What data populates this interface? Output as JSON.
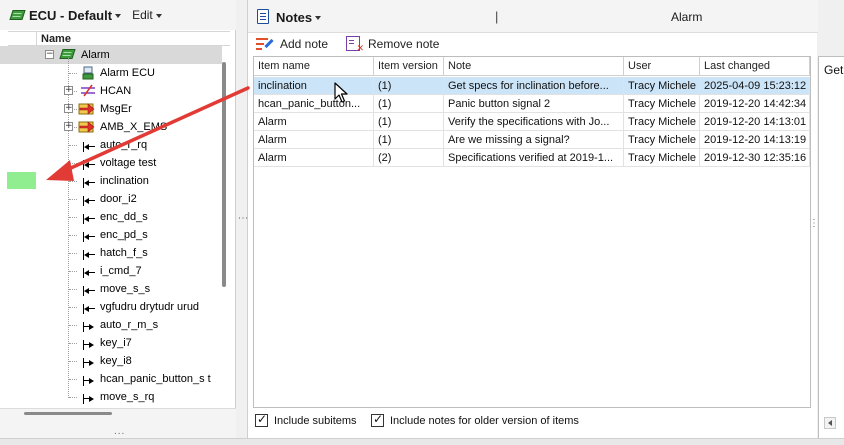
{
  "left_panel": {
    "title": "ECU - Default",
    "edit_menu": "Edit",
    "tree_header": "Name",
    "root": {
      "label": "Alarm"
    },
    "items": [
      {
        "label": "Alarm ECU",
        "icon": "ecu-module-icon"
      },
      {
        "label": "HCAN",
        "icon": "can-bus-icon"
      },
      {
        "label": "MsgEr",
        "icon": "message-icon"
      },
      {
        "label": "AMB_X_EMS",
        "icon": "message-icon"
      },
      {
        "label": "auto_r_rq",
        "icon": "signal-in-icon"
      },
      {
        "label": "voltage test",
        "icon": "signal-in-icon"
      },
      {
        "label": "inclination",
        "icon": "signal-in-icon"
      },
      {
        "label": "door_i2",
        "icon": "signal-in-icon"
      },
      {
        "label": "enc_dd_s",
        "icon": "signal-in-icon"
      },
      {
        "label": "enc_pd_s",
        "icon": "signal-in-icon"
      },
      {
        "label": "hatch_f_s",
        "icon": "signal-in-icon"
      },
      {
        "label": "i_cmd_7",
        "icon": "signal-in-icon"
      },
      {
        "label": "move_s_s",
        "icon": "signal-in-icon"
      },
      {
        "label": "vgfudru drytudr urud",
        "icon": "signal-in-icon"
      },
      {
        "label": "auto_r_m_s",
        "icon": "signal-out-icon"
      },
      {
        "label": "key_i7",
        "icon": "signal-out-icon"
      },
      {
        "label": "key_i8",
        "icon": "signal-out-icon"
      },
      {
        "label": "hcan_panic_button_s t",
        "icon": "signal-out-icon"
      },
      {
        "label": "move_s_rq",
        "icon": "signal-out-icon"
      }
    ],
    "bottom_grip": "..."
  },
  "notes_panel": {
    "title": "Notes",
    "separator": "|",
    "context_title": "Alarm",
    "add_note": "Add note",
    "remove_note": "Remove note",
    "columns": [
      "Item name",
      "Item version",
      "Note",
      "User",
      "Last changed"
    ],
    "rows": [
      {
        "item_name": "inclination",
        "item_version": "(1)",
        "note": "Get specs for inclination before...",
        "user": "Tracy Michele",
        "last_changed": "2025-04-09 15:23:12",
        "selected": true
      },
      {
        "item_name": "hcan_panic_button...",
        "item_version": "(1)",
        "note": "Panic button signal 2",
        "user": "Tracy Michele",
        "last_changed": "2019-12-20 14:42:34",
        "selected": false
      },
      {
        "item_name": "Alarm",
        "item_version": "(1)",
        "note": "Verify the specifications with Jo...",
        "user": "Tracy Michele",
        "last_changed": "2019-12-20 14:13:01",
        "selected": false
      },
      {
        "item_name": "Alarm",
        "item_version": "(1)",
        "note": "Are we missing a signal?",
        "user": "Tracy Michele",
        "last_changed": "2019-12-20 14:13:19",
        "selected": false
      },
      {
        "item_name": "Alarm",
        "item_version": "(2)",
        "note": "Specifications verified at 2019-1...",
        "user": "Tracy Michele",
        "last_changed": "2019-12-30 12:35:16",
        "selected": false
      }
    ],
    "include_subitems": "Include subitems",
    "include_older": "Include notes for older version of items"
  },
  "right_panel": {
    "text": "Get"
  },
  "colors": {
    "selection_row": "#cce4f7",
    "tree_selection": "#d9d9d9",
    "highlight_swatch": "#90ee90",
    "annotation_arrow": "#e23b36"
  }
}
